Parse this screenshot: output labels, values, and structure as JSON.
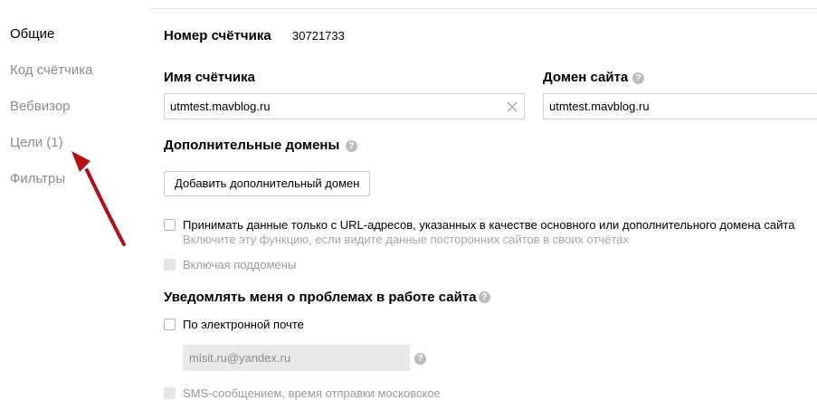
{
  "sidebar": {
    "items": [
      {
        "label": "Общие",
        "active": true
      },
      {
        "label": "Код счётчика",
        "active": false
      },
      {
        "label": "Вебвизор",
        "active": false
      },
      {
        "label": "Цели (1)",
        "active": false
      },
      {
        "label": "Фильтры",
        "active": false
      }
    ]
  },
  "counter": {
    "number_label": "Номер счётчика",
    "number_value": "30721733",
    "name_label": "Имя счётчика",
    "name_value": "utmtest.mavblog.ru",
    "domain_label": "Домен сайта",
    "domain_value": "utmtest.mavblog.ru"
  },
  "extra_domains": {
    "title": "Дополнительные домены",
    "add_button": "Добавить дополнительный домен",
    "only_urls_label": "Принимать данные только с URL-адресов, указанных в качестве основного или дополнительного домена сайта",
    "only_urls_hint": "Включите эту функцию, если видите данные посторонних сайтов в своих отчётах",
    "subdomains_label": "Включая поддомены"
  },
  "notify": {
    "title": "Уведомлять меня о проблемах в работе сайта",
    "email_label": "По электронной почте",
    "email_value": "mlsit.ru@yandex.ru",
    "sms_label": "SMS-сообщением, время отправки московское"
  },
  "icons": {
    "help": "?",
    "clear": "close-icon"
  },
  "colors": {
    "arrow": "#b30f14",
    "muted_text": "#8c8c8c"
  }
}
